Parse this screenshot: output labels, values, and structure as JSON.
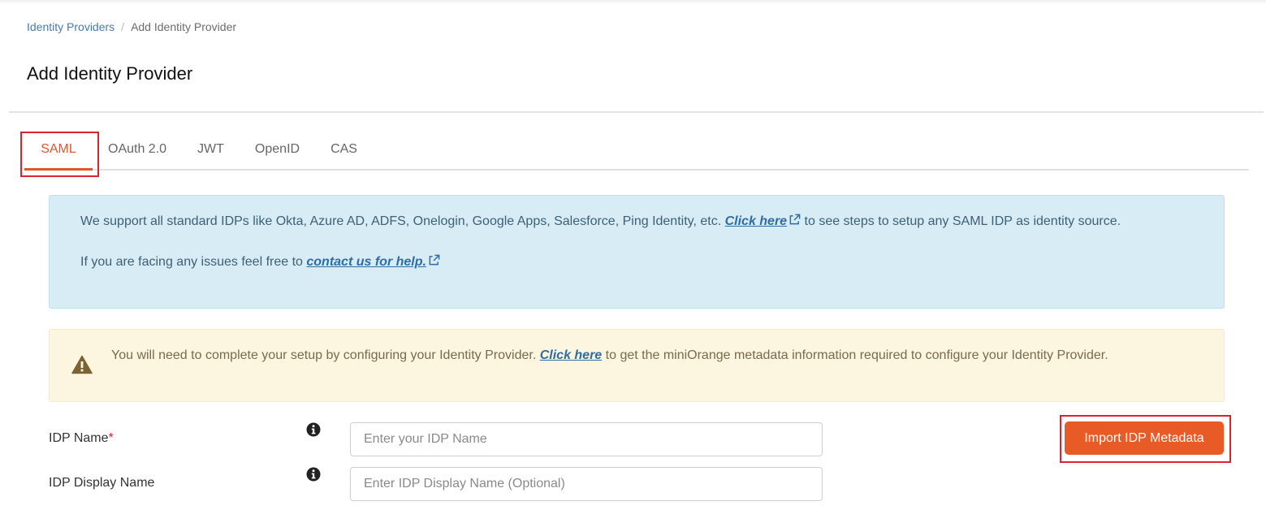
{
  "breadcrumb": {
    "parent": "Identity Providers",
    "separator": "/",
    "current": "Add Identity Provider"
  },
  "page": {
    "title": "Add Identity Provider"
  },
  "tabs": [
    {
      "label": "SAML",
      "active": true
    },
    {
      "label": "OAuth 2.0",
      "active": false
    },
    {
      "label": "JWT",
      "active": false
    },
    {
      "label": "OpenID",
      "active": false
    },
    {
      "label": "CAS",
      "active": false
    }
  ],
  "info_alert": {
    "line1_before": "We support all standard IDPs like Okta, Azure AD, ADFS, Onelogin, Google Apps, Salesforce, Ping Identity, etc. ",
    "line1_link": "Click here",
    "line1_after": " to see steps to setup any SAML IDP as identity source.",
    "line2_before": "If you are facing any issues feel free to ",
    "line2_link": "contact us for help."
  },
  "warning_alert": {
    "text_before": "You will need to complete your setup by configuring your Identity Provider. ",
    "link": "Click here",
    "text_after": " to get the miniOrange metadata information required to configure your Identity Provider."
  },
  "form": {
    "idp_name": {
      "label": "IDP Name",
      "required_mark": "*",
      "value": "",
      "placeholder": "Enter your IDP Name"
    },
    "idp_display_name": {
      "label": "IDP Display Name",
      "value": "",
      "placeholder": "Enter IDP Display Name (Optional)"
    },
    "import_button": "Import IDP Metadata"
  },
  "colors": {
    "accent": "#e85a26",
    "active_tab": "#e0572a",
    "highlight": "#d9232e",
    "link": "#2e6da4",
    "info_bg": "#d8ecf6",
    "warning_bg": "#fcf6e0"
  }
}
